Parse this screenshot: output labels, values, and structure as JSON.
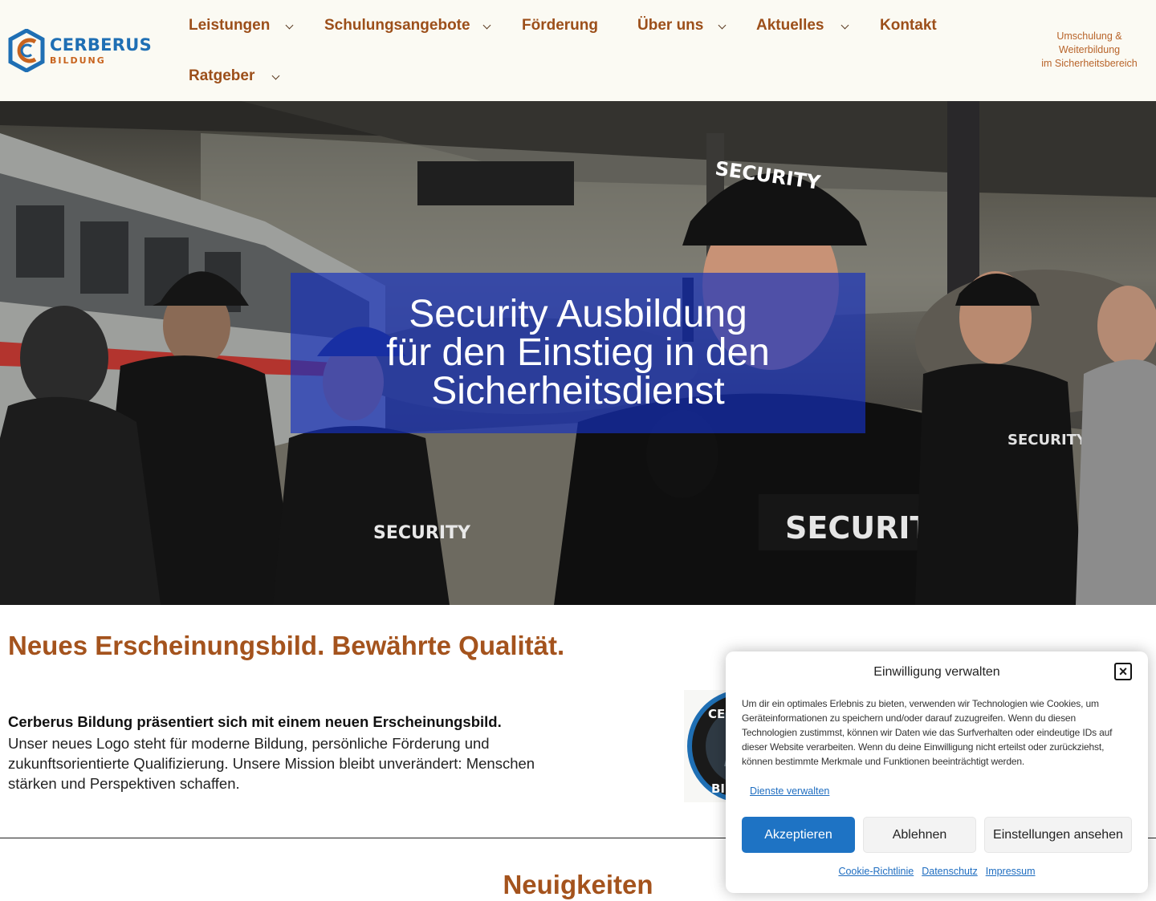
{
  "header": {
    "logo": {
      "title": "CERBERUS",
      "subtitle": "BILDUNG"
    },
    "nav": {
      "leistungen": "Leistungen",
      "schulungsangebote": "Schulungsangebote",
      "foerderung": "Förderung",
      "ueber_uns": "Über uns",
      "aktuelles": "Aktuelles",
      "kontakt": "Kontakt",
      "ratgeber": "Ratgeber"
    },
    "tagline": {
      "line1": "Umschulung &",
      "line2": "Weiterbildung",
      "line3": "im Sicherheitsbereich"
    }
  },
  "hero": {
    "title_line1": "Security Ausbildung",
    "title_line2": "für den Einstieg in den",
    "title_line3": "Sicherheitsdienst",
    "vest_label": "SECURITY"
  },
  "section": {
    "title": "Neues Erscheinungsbild. Bewährte Qualität.",
    "lead": "Cerberus Bildung präsentiert sich mit einem neuen Erscheinungsbild.",
    "body": "Unser neues Logo steht für moderne Bildung, persönliche Förderung und zukunftsorientierte Qualifizierung. Unsere Mission bleibt unverändert: Menschen stärken und Perspektiven schaffen."
  },
  "news": {
    "title": "Neuigkeiten"
  },
  "cookie": {
    "title": "Einwilligung verwalten",
    "close_icon": "×",
    "text": "Um dir ein optimales Erlebnis zu bieten, verwenden wir Technologien wie Cookies, um Geräteinformationen zu speichern und/oder darauf zuzugreifen. Wenn du diesen Technologien zustimmst, können wir Daten wie das Surfverhalten oder eindeutige IDs auf dieser Website verarbeiten. Wenn du deine Einwilligung nicht erteilst oder zurückziehst, können bestimmte Merkmale und Funktionen beeinträchtigt werden.",
    "manage_link": "Dienste verwalten",
    "accept": "Akzeptieren",
    "deny": "Ablehnen",
    "settings": "Einstellungen ansehen",
    "links": {
      "cookie_policy": "Cookie-Richtlinie",
      "privacy": "Datenschutz",
      "imprint": "Impressum"
    }
  },
  "colors": {
    "brand_blue": "#1f6fb4",
    "brand_orange": "#c8641f",
    "heading_brown": "#a4531d",
    "button_blue": "#1e73c4"
  }
}
